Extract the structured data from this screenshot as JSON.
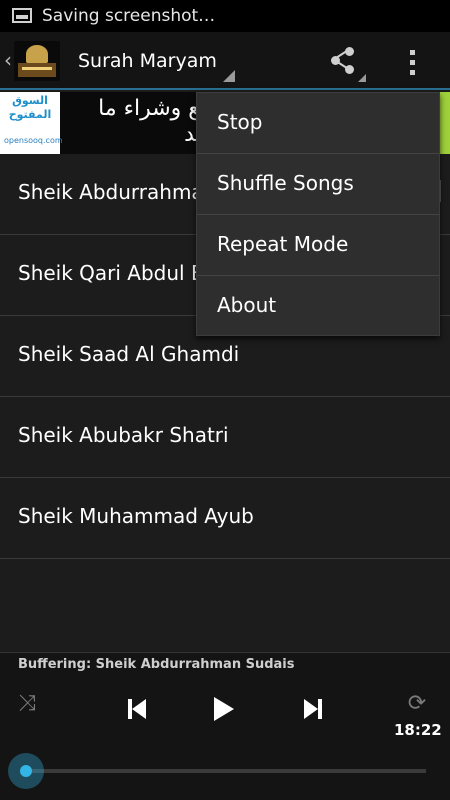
{
  "status_bar": {
    "text": "Saving screenshot…",
    "icon": "screenshot-icon"
  },
  "action_bar": {
    "title": "Surah Maryam",
    "share_icon": "share-icon",
    "overflow_icon": "overflow-menu-icon"
  },
  "ad": {
    "logo_text": "السوق المفتوح",
    "logo_brand": "opensooq.com",
    "text": "لبيع وشراء ما تريد",
    "accent_color": "#9fd13a"
  },
  "list": {
    "items": [
      {
        "label": "Sheik Abdurrahman Sudais"
      },
      {
        "label": "Sheik Qari Abdul Basit"
      },
      {
        "label": "Sheik Saad Al Ghamdi"
      },
      {
        "label": "Sheik Abubakr Shatri"
      },
      {
        "label": "Sheik Muhammad Ayub"
      }
    ]
  },
  "menu": {
    "items": [
      {
        "label": "Stop"
      },
      {
        "label": "Shuffle Songs"
      },
      {
        "label": "Repeat Mode"
      },
      {
        "label": "About"
      }
    ]
  },
  "player": {
    "status": "Buffering: Sheik Abdurrahman Sudais",
    "time": "18:22",
    "progress": 0.0,
    "accent_color": "#33b5e5",
    "shuffle_icon": "shuffle-icon",
    "prev_icon": "previous-icon",
    "play_icon": "play-icon",
    "next_icon": "next-icon",
    "repeat_icon": "repeat-icon"
  }
}
